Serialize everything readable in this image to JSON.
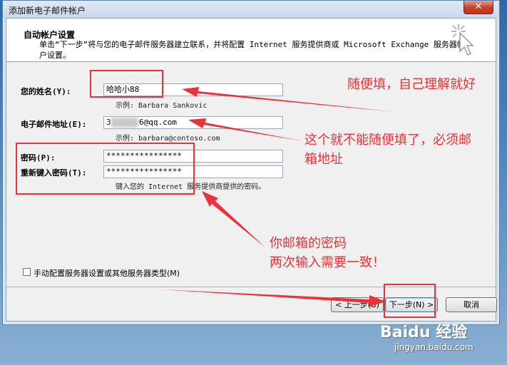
{
  "window": {
    "title": "添加新电子邮件帐户",
    "close_label": "✕"
  },
  "header": {
    "title": "自动帐户设置",
    "description": "单击“下一步”将与您的电子邮件服务器建立联系，并将配置 Internet 服务提供商或 Microsoft Exchange 服务器帐户设置。",
    "icon": "wand-cursor-icon"
  },
  "form": {
    "name_label": "您的姓名(Y):",
    "name_value": "哈哈小88",
    "name_hint": "示例: Barbara Sankovic",
    "email_label": "电子邮件地址(E):",
    "email_value_prefix": "3",
    "email_value_suffix": "6@qq.com",
    "email_hint": "示例: barbara@contoso.com",
    "password_label": "密码(P):",
    "password_value": "****************",
    "retype_label": "重新键入密码(T):",
    "retype_value": "****************",
    "password_hint": "键入您的 Internet 服务提供商提供的密码。"
  },
  "manual": {
    "label": "手动配置服务器设置或其他服务器类型(M)",
    "checked": false
  },
  "buttons": {
    "back": "< 上一步(B)",
    "next": "下一步(N) >",
    "cancel": "取消"
  },
  "annotations": {
    "name_note": "随便填，自己理解就好",
    "email_note_line1": "这个就不能随便填了，必须邮",
    "email_note_line2": "箱地址",
    "password_note_line1": "你邮箱的密码",
    "password_note_line2": "两次输入需要一致！",
    "color": "#e8333a"
  },
  "watermark": {
    "logo": "Baidu 经验",
    "url": "jingyan.baidu.com"
  }
}
